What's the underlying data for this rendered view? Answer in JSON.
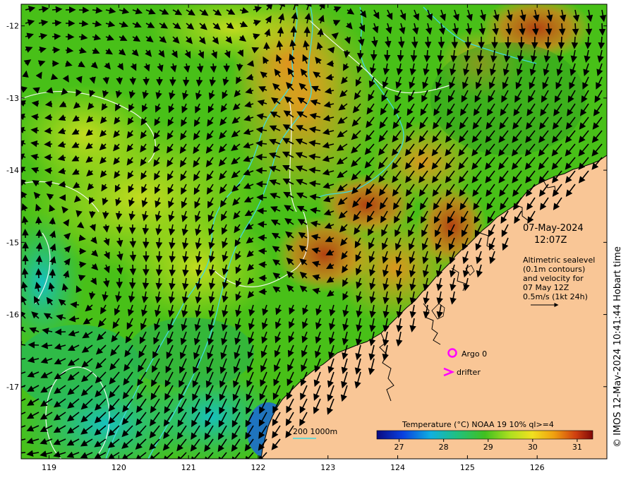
{
  "map": {
    "lon_ticks": [
      "119",
      "120",
      "121",
      "122",
      "123",
      "124",
      "125",
      "126"
    ],
    "lat_ticks": [
      "-12",
      "-13",
      "-14",
      "-15",
      "-16",
      "-17"
    ],
    "lon_range": [
      118.6,
      127.0
    ],
    "lat_range": [
      -11.7,
      -18.0
    ]
  },
  "info": {
    "date": "07-May-2024",
    "time": "12:07Z",
    "desc": [
      "Altimetric sealevel",
      "(0.1m contours)",
      "and velocity for",
      "07 May 12Z",
      "0.5m/s (1kt 24h)"
    ]
  },
  "legend": {
    "argo": "Argo 0",
    "drifter": "drifter",
    "bathy": "200  1000m",
    "colorbar_title": "Temperature (°C) NOAA 19 10% ql>=4",
    "colorbar_ticks": [
      "27",
      "28",
      "29",
      "30",
      "31"
    ],
    "colorbar_range": [
      26.5,
      31.35
    ]
  },
  "credit": "© IMOS 12-May-2024 10:41:44 Hobart time",
  "colors": {
    "land": "#f9c696",
    "bathy_line": "#40d8e0",
    "argo_marker": "#ff00ff",
    "contour": "#ffffff"
  }
}
